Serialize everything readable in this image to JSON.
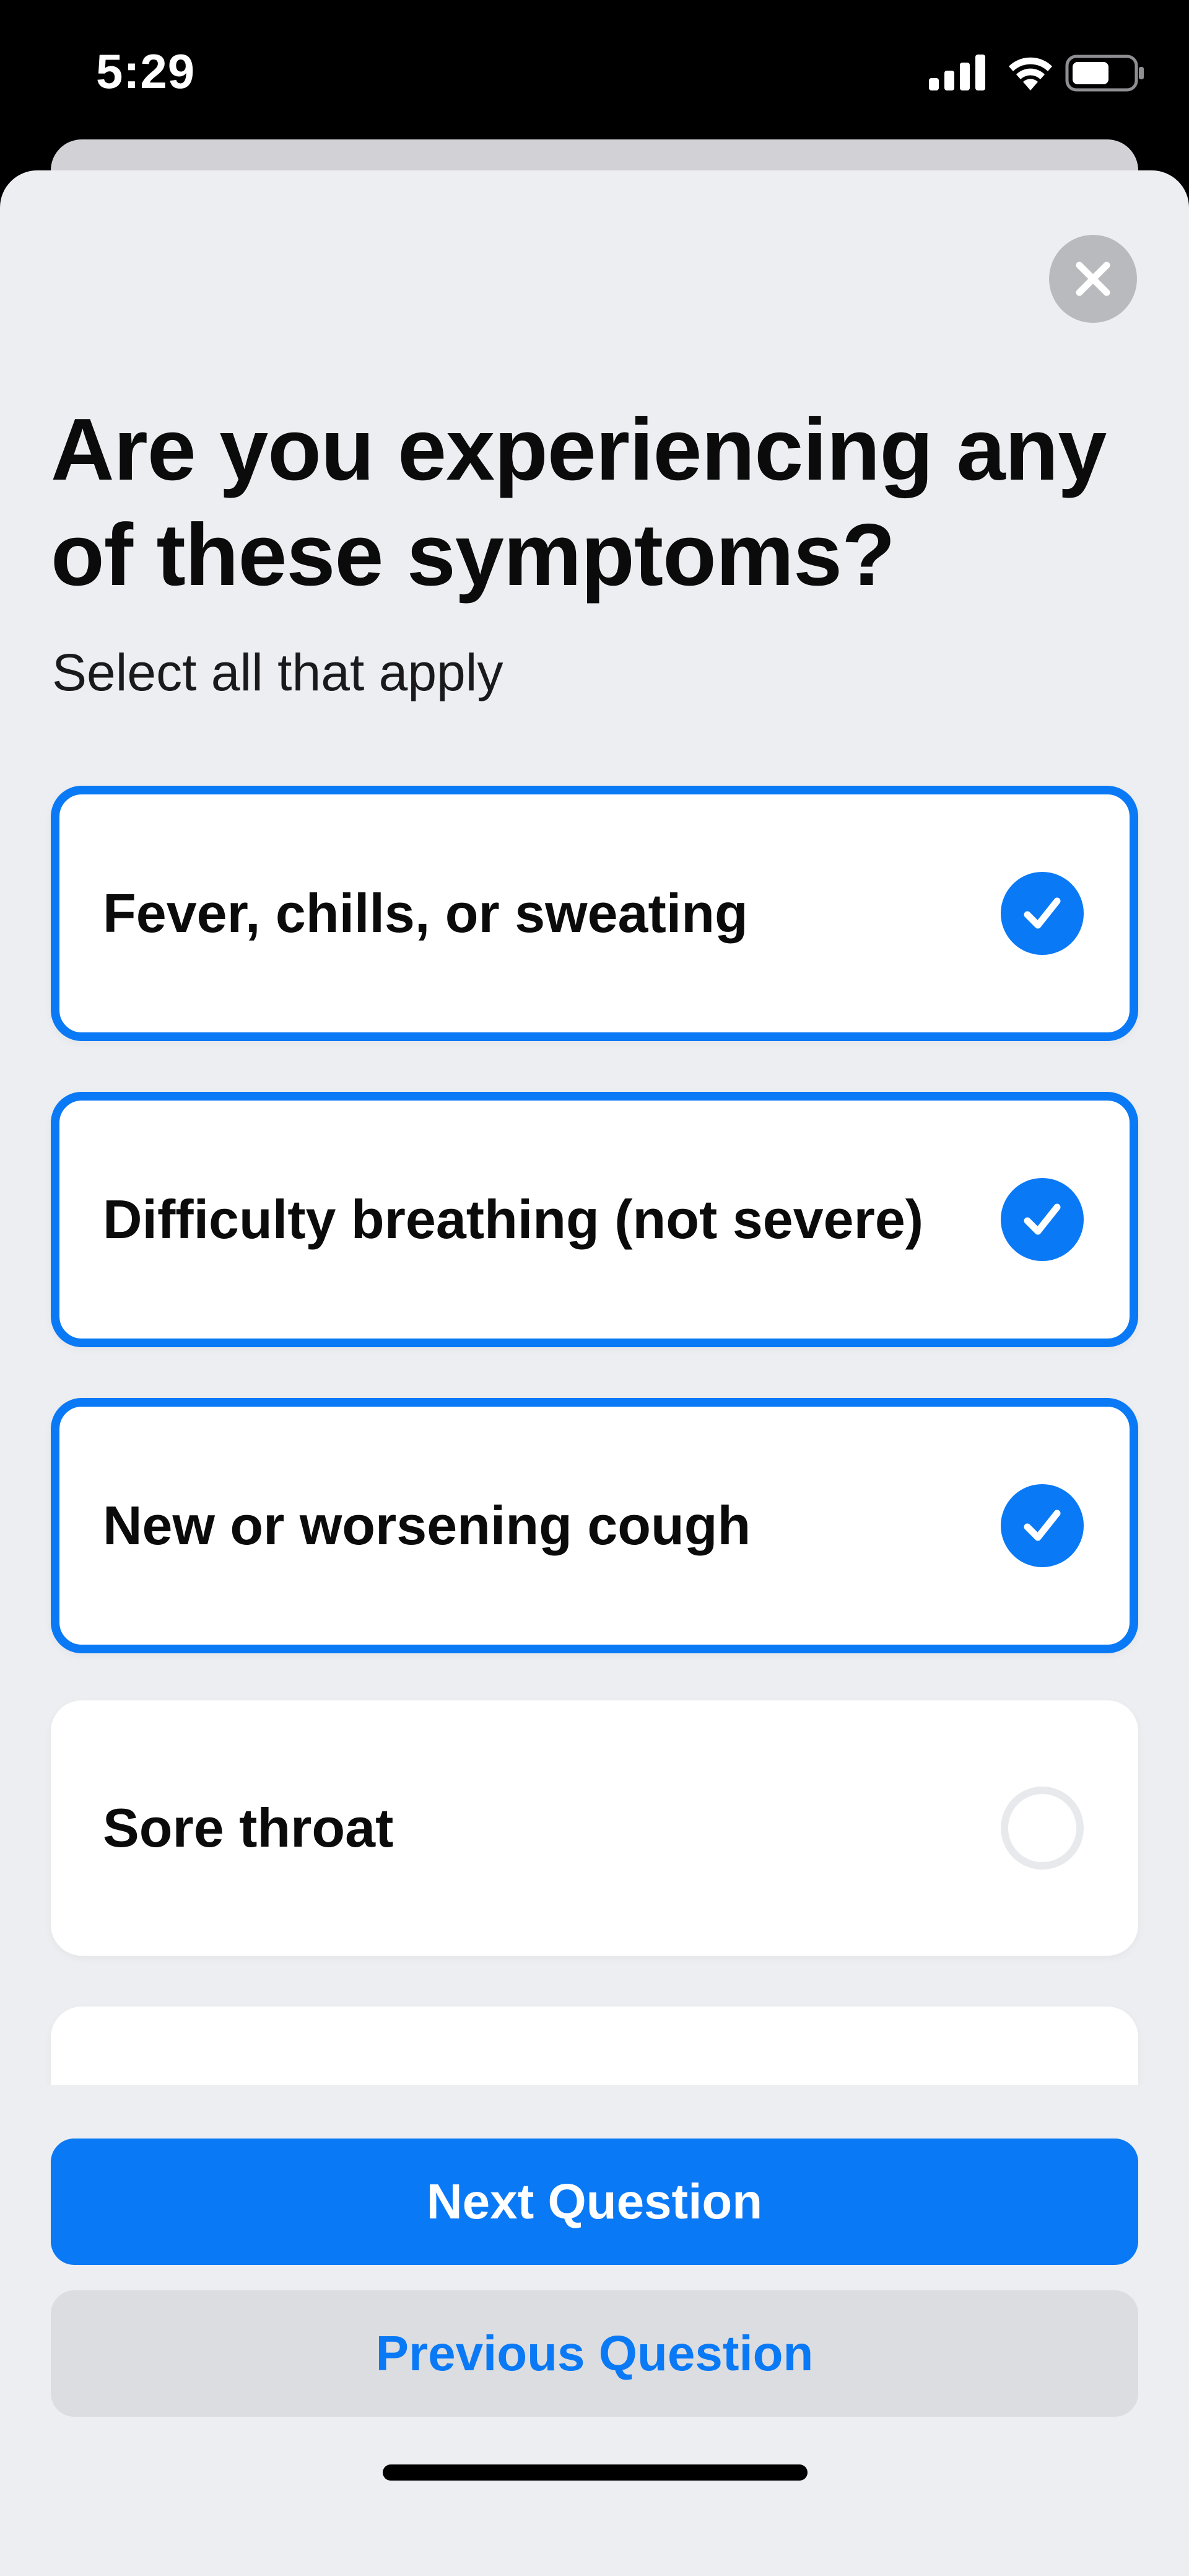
{
  "status_bar": {
    "time": "5:29",
    "icons": [
      "signal-icon",
      "wifi-icon",
      "battery-icon"
    ]
  },
  "sheet": {
    "close_icon": "close-icon",
    "title": "Are you experiencing any of these symptoms?",
    "subtitle": "Select all that apply",
    "options": [
      {
        "label": "Fever, chills, or sweating",
        "selected": true
      },
      {
        "label": "Difficulty breathing (not severe)",
        "selected": true
      },
      {
        "label": "New or worsening cough",
        "selected": true
      },
      {
        "label": "Sore throat",
        "selected": false
      },
      {
        "label": "",
        "selected": false
      }
    ]
  },
  "footer": {
    "next_label": "Next Question",
    "previous_label": "Previous Question"
  },
  "colors": {
    "accent": "#0a79f6",
    "sheet_background": "#eceef1",
    "card_background": "#ffffff"
  }
}
